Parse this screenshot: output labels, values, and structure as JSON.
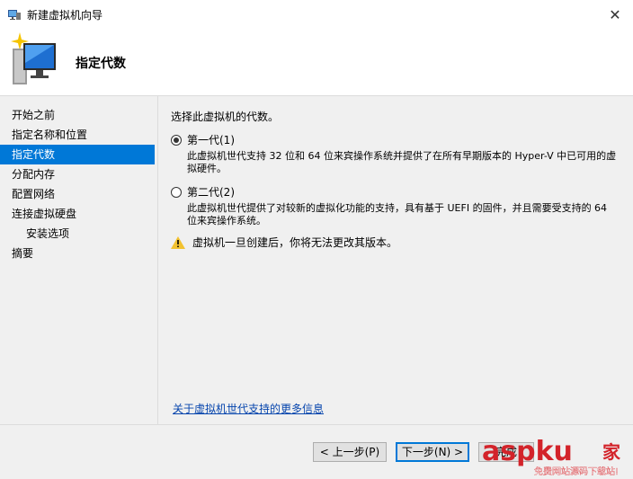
{
  "window": {
    "title": "新建虚拟机向导",
    "close_glyph": "✕"
  },
  "header": {
    "title": "指定代数"
  },
  "nav": {
    "items": [
      {
        "label": "开始之前"
      },
      {
        "label": "指定名称和位置"
      },
      {
        "label": "指定代数"
      },
      {
        "label": "分配内存"
      },
      {
        "label": "配置网络"
      },
      {
        "label": "连接虚拟硬盘"
      },
      {
        "label": "安装选项"
      },
      {
        "label": "摘要"
      }
    ],
    "selected_index": 2
  },
  "content": {
    "prompt": "选择此虚拟机的代数。",
    "option1": {
      "label": "第一代(1)",
      "checked": true,
      "description": "此虚拟机世代支持 32 位和 64 位来宾操作系统并提供了在所有早期版本的 Hyper-V 中已可用的虚拟硬件。"
    },
    "option2": {
      "label": "第二代(2)",
      "checked": false,
      "description": "此虚拟机世代提供了对较新的虚拟化功能的支持，具有基于 UEFI 的固件，并且需要受支持的 64 位来宾操作系统。"
    },
    "warning": "虚拟机一旦创建后，你将无法更改其版本。",
    "more_link": "关于虚拟机世代支持的更多信息"
  },
  "buttons": {
    "prev": "< 上一步(P)",
    "next": "下一步(N) >",
    "finish": "完成"
  },
  "watermark": {
    "brand": "aspku",
    "suffix": "家",
    "tagline": "免费网站源码下载站!"
  },
  "colors": {
    "accent": "#0078d7",
    "link": "#0645ad",
    "panel": "#f0f0f0"
  }
}
